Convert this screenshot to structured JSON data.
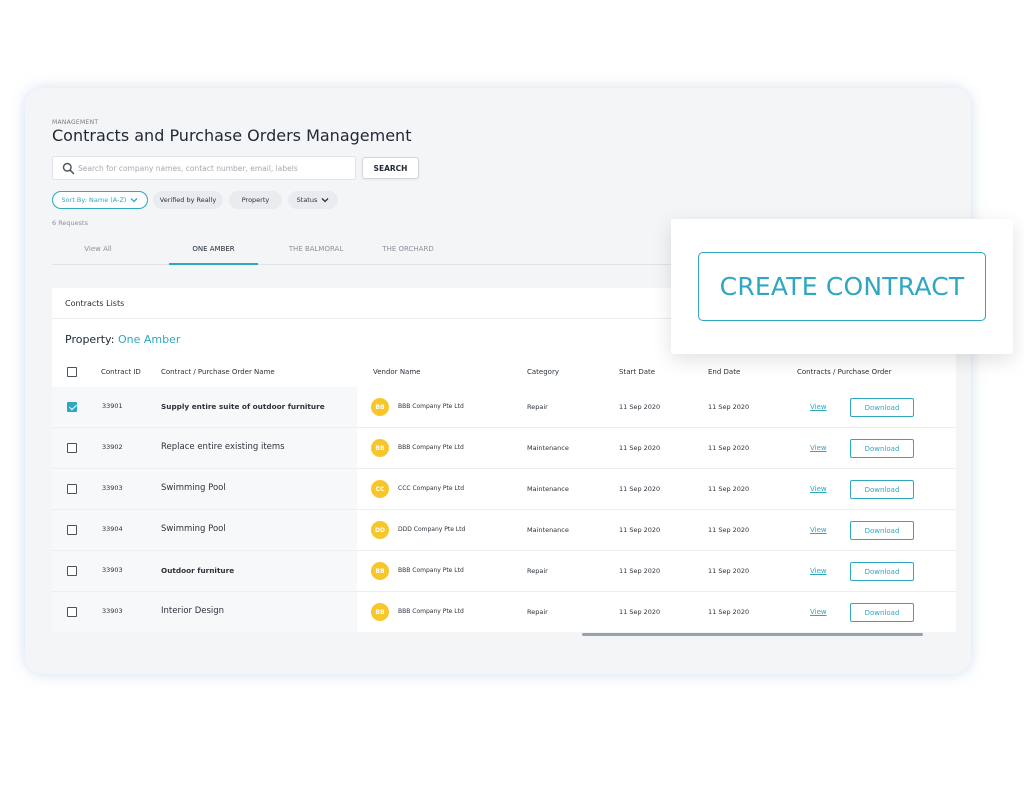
{
  "header": {
    "section_label": "MANAGEMENT",
    "title": "Contracts and Purchase Orders Management"
  },
  "search": {
    "placeholder": "Search for company names, contact number, email, labels",
    "button_label": "SEARCH"
  },
  "filters": {
    "sort": "Sort By: Name (A-Z)",
    "verified": "Verified by Really",
    "property": "Property",
    "status": "Status"
  },
  "requests_count": "6 Requests",
  "tabs": [
    {
      "label": "View All"
    },
    {
      "label": "ONE AMBER"
    },
    {
      "label": "THE BALMORAL"
    },
    {
      "label": "THE ORCHARD"
    }
  ],
  "active_tab": "ONE AMBER",
  "table": {
    "title": "Contracts Lists",
    "property_prefix": "Property:",
    "property_value": "One Amber",
    "columns": {
      "id": "Contract ID",
      "name": "Contract / Purchase Order Name",
      "vendor": "Vendor Name",
      "category": "Category",
      "start": "Start Date",
      "end": "End Date",
      "docs": "Contracts / Purchase Order"
    },
    "rows": [
      {
        "checked": true,
        "id": "33901",
        "name": "Supply entire suite of outdoor furniture",
        "initials": "BB",
        "vendor": "BBB Company Pte Ltd",
        "category": "Repair",
        "start": "11 Sep 2020",
        "end": "11 Sep 2020",
        "view": "View",
        "download": "Download"
      },
      {
        "checked": false,
        "id": "33902",
        "name": "Replace entire existing items",
        "initials": "BB",
        "vendor": "BBB Company Pte Ltd",
        "category": "Maintenance",
        "start": "11 Sep 2020",
        "end": "11 Sep 2020",
        "view": "View",
        "download": "Download"
      },
      {
        "checked": false,
        "id": "33903",
        "name": "Swimming Pool",
        "initials": "CC",
        "vendor": "CCC Company Pte Ltd",
        "category": "Maintenance",
        "start": "11 Sep 2020",
        "end": "11 Sep 2020",
        "view": "View",
        "download": "Download"
      },
      {
        "checked": false,
        "id": "33904",
        "name": "Swimming Pool",
        "initials": "DD",
        "vendor": "DDD Company Pte Ltd",
        "category": "Maintenance",
        "start": "11 Sep 2020",
        "end": "11 Sep 2020",
        "view": "View",
        "download": "Download"
      },
      {
        "checked": false,
        "id": "33903",
        "name": "Outdoor furniture",
        "initials": "BB",
        "vendor": "BBB Company Pte Ltd",
        "category": "Repair",
        "start": "11 Sep 2020",
        "end": "11 Sep 2020",
        "view": "View",
        "download": "Download"
      },
      {
        "checked": false,
        "id": "33903",
        "name": "Interior Design",
        "initials": "BB",
        "vendor": "BBB Company Pte Ltd",
        "category": "Repair",
        "start": "11 Sep 2020",
        "end": "11 Sep 2020",
        "view": "View",
        "download": "Download"
      }
    ]
  },
  "callout": {
    "create_label": "CREATE CONTRACT"
  },
  "colors": {
    "accent": "#2fa7c0",
    "avatar": "#f7c62a",
    "window_bg": "#f4f5f7"
  }
}
